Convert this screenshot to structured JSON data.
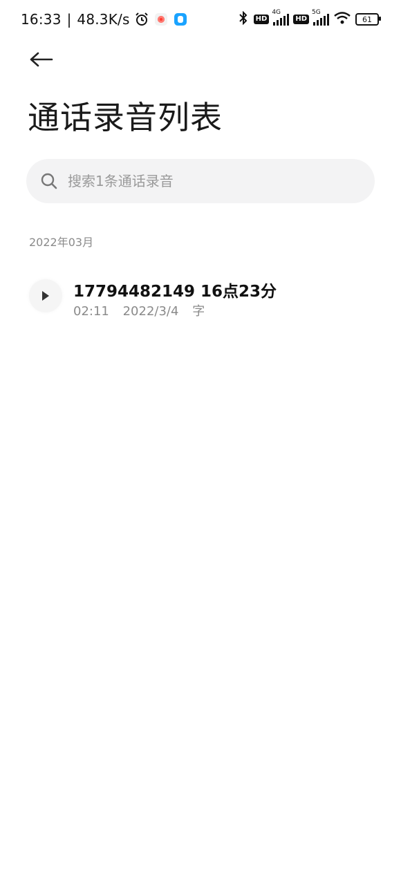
{
  "status_bar": {
    "time": "16:33",
    "separator": "|",
    "net_speed": "48.3K/s",
    "icons_left": [
      "alarm-icon",
      "recorder-app-icon",
      "messenger-app-icon"
    ],
    "icons_right": [
      "bluetooth-icon",
      "hd-badge",
      "4g-signal-icon",
      "hd-badge",
      "5g-signal-icon",
      "wifi-icon",
      "battery-icon"
    ],
    "hd_label": "HD",
    "sig1_label": "4G",
    "sig2_label": "5G",
    "battery": "61"
  },
  "header": {
    "back_icon": "arrow-left-icon",
    "title": "通话录音列表"
  },
  "search": {
    "placeholder": "搜索1条通话录音",
    "value": ""
  },
  "groups": [
    {
      "label": "2022年03月",
      "items": [
        {
          "title": "17794482149 16点23分",
          "duration": "02:11",
          "date": "2022/3/4",
          "tag": "字"
        }
      ]
    }
  ]
}
